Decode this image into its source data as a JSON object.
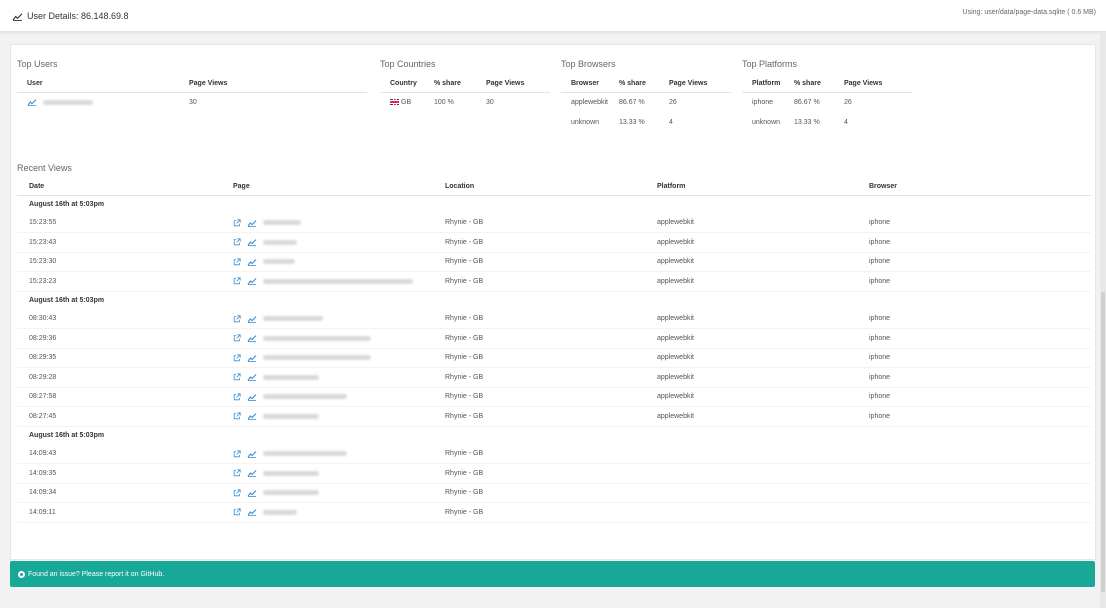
{
  "header": {
    "title": "User Details: 86.148.69.8",
    "using": "Using: user/data/page-data.sqlite ( 0.6 MB)"
  },
  "top_users": {
    "title": "Top Users",
    "columns": [
      "User",
      "Page Views"
    ],
    "rows": [
      {
        "views": "30"
      }
    ]
  },
  "top_countries": {
    "title": "Top Countries",
    "columns": [
      "Country",
      "% share",
      "Page Views"
    ],
    "rows": [
      {
        "country": "GB",
        "share": "100 %",
        "views": "30"
      }
    ]
  },
  "top_browsers": {
    "title": "Top Browsers",
    "columns": [
      "Browser",
      "% share",
      "Page Views"
    ],
    "rows": [
      {
        "name": "applewebkit",
        "share": "86.67 %",
        "views": "26"
      },
      {
        "name": "unknown",
        "share": "13.33 %",
        "views": "4"
      }
    ]
  },
  "top_platforms": {
    "title": "Top Platforms",
    "columns": [
      "Platform",
      "% share",
      "Page Views"
    ],
    "rows": [
      {
        "name": "iphone",
        "share": "86.67 %",
        "views": "26"
      },
      {
        "name": "unknown",
        "share": "13.33 %",
        "views": "4"
      }
    ]
  },
  "recent": {
    "title": "Recent Views",
    "columns": [
      "Date",
      "Page",
      "Location",
      "Platform",
      "Browser"
    ],
    "groups": [
      {
        "date": "August 16th at 5:03pm",
        "rows": [
          {
            "time": "15:23:55",
            "location": "Rhynie - GB",
            "platform": "applewebkit",
            "browser": "iphone"
          },
          {
            "time": "15:23:43",
            "location": "Rhynie - GB",
            "platform": "applewebkit",
            "browser": "iphone"
          },
          {
            "time": "15:23:30",
            "location": "Rhynie - GB",
            "platform": "applewebkit",
            "browser": "iphone"
          },
          {
            "time": "15:23:23",
            "location": "Rhynie - GB",
            "platform": "applewebkit",
            "browser": "iphone"
          }
        ]
      },
      {
        "date": "August 16th at 5:03pm",
        "rows": [
          {
            "time": "08:30:43",
            "location": "Rhynie - GB",
            "platform": "applewebkit",
            "browser": "iphone"
          },
          {
            "time": "08:29:36",
            "location": "Rhynie - GB",
            "platform": "applewebkit",
            "browser": "iphone"
          },
          {
            "time": "08:29:35",
            "location": "Rhynie - GB",
            "platform": "applewebkit",
            "browser": "iphone"
          },
          {
            "time": "08:29:28",
            "location": "Rhynie - GB",
            "platform": "applewebkit",
            "browser": "iphone"
          },
          {
            "time": "08:27:58",
            "location": "Rhynie - GB",
            "platform": "applewebkit",
            "browser": "iphone"
          },
          {
            "time": "08:27:45",
            "location": "Rhynie - GB",
            "platform": "applewebkit",
            "browser": "iphone"
          }
        ]
      },
      {
        "date": "August 16th at 5:03pm",
        "rows": [
          {
            "time": "14:09:43",
            "location": "Rhynie - GB",
            "platform": "",
            "browser": ""
          },
          {
            "time": "14:09:35",
            "location": "Rhynie - GB",
            "platform": "",
            "browser": ""
          },
          {
            "time": "14:09:34",
            "location": "Rhynie - GB",
            "platform": "",
            "browser": ""
          },
          {
            "time": "14:09:11",
            "location": "Rhynie - GB",
            "platform": "",
            "browser": ""
          }
        ]
      }
    ]
  },
  "footer": {
    "text": "Found an issue? Please report it on GitHub."
  },
  "colors": {
    "accent": "#17a898",
    "link": "#3a8fd8"
  },
  "icons": {
    "chart": "chart-line-icon",
    "external": "external-link-icon",
    "github": "github-icon"
  }
}
